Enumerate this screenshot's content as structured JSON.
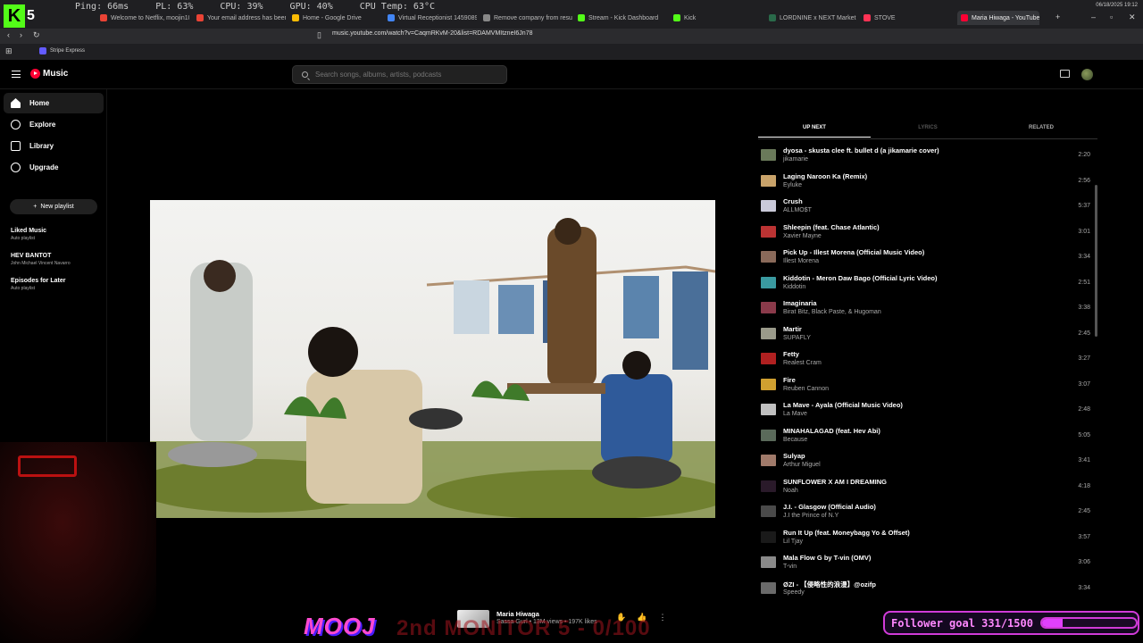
{
  "browser": {
    "stats": [
      "Ping: 66ms",
      "PL: 63%",
      "CPU: 39%",
      "GPU: 40%",
      "CPU Temp: 63°C"
    ],
    "datetime": "06/18/2025 19:12",
    "tabs": [
      {
        "label": "Welcome to Netflix, moojin10...",
        "color": "#ea4335"
      },
      {
        "label": "Your email address has been c...",
        "color": "#ea4335"
      },
      {
        "label": "Home - Google Drive",
        "color": "#fbbc04"
      },
      {
        "label": "Virtual Receptionist 1459089 ...",
        "color": "#4285f4"
      },
      {
        "label": "Remove company from resume...",
        "color": "#888888"
      },
      {
        "label": "Stream - Kick Dashboard",
        "color": "#53fc18"
      },
      {
        "label": "Kick",
        "color": "#53fc18"
      },
      {
        "label": "LORDNINE x NEXT Market",
        "color": "#2a6a4a"
      },
      {
        "label": "STOVE",
        "color": "#ff3355"
      },
      {
        "label": "Maria Hiwaga - YouTube",
        "color": "#ff0033",
        "active": true
      }
    ],
    "url": "music.youtube.com/watch?v=CaqmRKvM-20&list=RDAMVMItzneI6Jn78",
    "bookmark": "Stripe Express"
  },
  "app": {
    "logo": "Music",
    "search_placeholder": "Search songs, albums, artists, podcasts",
    "nav": [
      {
        "label": "Home",
        "icon": "home-icon",
        "active": true
      },
      {
        "label": "Explore",
        "icon": "compass-icon"
      },
      {
        "label": "Library",
        "icon": "library-icon"
      },
      {
        "label": "Upgrade",
        "icon": "upgrade-icon"
      }
    ],
    "new_playlist": "New playlist",
    "playlists": [
      {
        "title": "Liked Music",
        "sub": "Auto playlist"
      },
      {
        "title": "HEV BANTOT",
        "sub": "John Michael Vincent Navarro"
      },
      {
        "title": "Episodes for Later",
        "sub": "Auto playlist"
      }
    ],
    "tabs": [
      "UP NEXT",
      "LYRICS",
      "RELATED"
    ],
    "queue": [
      {
        "title": "dyosa - skusta clee ft. bullet d (a jikamarie cover)",
        "artist": "jikamarie",
        "duration": "2:20",
        "color": "#6a7a5a"
      },
      {
        "title": "Laging Naroon Ka (Remix)",
        "artist": "Eyluke",
        "duration": "2:56",
        "color": "#c9a36a"
      },
      {
        "title": "Crush",
        "artist": "ALLMO$T",
        "duration": "5:37",
        "color": "#c9c9d9"
      },
      {
        "title": "Shleepin (feat. Chase Atlantic)",
        "artist": "Xavier Mayne",
        "duration": "3:01",
        "color": "#b33"
      },
      {
        "title": "Pick Up - Illest Morena (Official Music Video)",
        "artist": "Illest Morena",
        "duration": "3:34",
        "color": "#8a6a5a"
      },
      {
        "title": "Kiddotin - Meron Daw Bago (Official Lyric Video)",
        "artist": "Kiddotin",
        "duration": "2:51",
        "color": "#3a9aa0"
      },
      {
        "title": "Imaginaria",
        "artist": "Birat Bitz, Black Paste, & Hugoman",
        "duration": "3:38",
        "color": "#8a3a4a"
      },
      {
        "title": "Martir",
        "artist": "SUPAFLY",
        "duration": "2:45",
        "color": "#9a9a8a"
      },
      {
        "title": "Fetty",
        "artist": "Realest Cram",
        "duration": "3:27",
        "color": "#b02020"
      },
      {
        "title": "Fire",
        "artist": "Reuben Cannon",
        "duration": "3:07",
        "color": "#d0a030"
      },
      {
        "title": "La Mave - Ayala (Official Music Video)",
        "artist": "La Mave",
        "duration": "2:48",
        "color": "#c0c0c0"
      },
      {
        "title": "MINAHALAGAD (feat. Hev Abi)",
        "artist": "Because",
        "duration": "5:05",
        "color": "#5a6a5a"
      },
      {
        "title": "Sulyap",
        "artist": "Arthur Miguel",
        "duration": "3:41",
        "color": "#a07a6a"
      },
      {
        "title": "SUNFLOWER X AM I DREAMING",
        "artist": "Noah",
        "duration": "4:18",
        "color": "#2a1a2a"
      },
      {
        "title": "J.I. - Glasgow (Official Audio)",
        "artist": "J.I the Prince of N.Y",
        "duration": "2:45",
        "color": "#4a4a4a"
      },
      {
        "title": "Run It Up (feat. Moneybagg Yo & Offset)",
        "artist": "Lil Tjay",
        "duration": "3:57",
        "color": "#1a1a1a"
      },
      {
        "title": "Mala Flow G by T-vin (OMV)",
        "artist": "T-vin",
        "duration": "3:06",
        "color": "#8a8a8a"
      },
      {
        "title": "ØZI - 【侵略性的浪漫】@ozifp",
        "artist": "Speedy",
        "duration": "3:34",
        "color": "#6a6a6a"
      }
    ],
    "player": {
      "title": "Maria Hiwaga",
      "sub": "Sassa Gurl • 13M views • 197K likes"
    }
  },
  "overlays": {
    "kick_count": "5",
    "mooj": "MOOJ",
    "monitor": "2nd MONITOR 5 - 0/100",
    "follower_label": "Follower goal 331/1500",
    "follower_progress": 0.22
  }
}
